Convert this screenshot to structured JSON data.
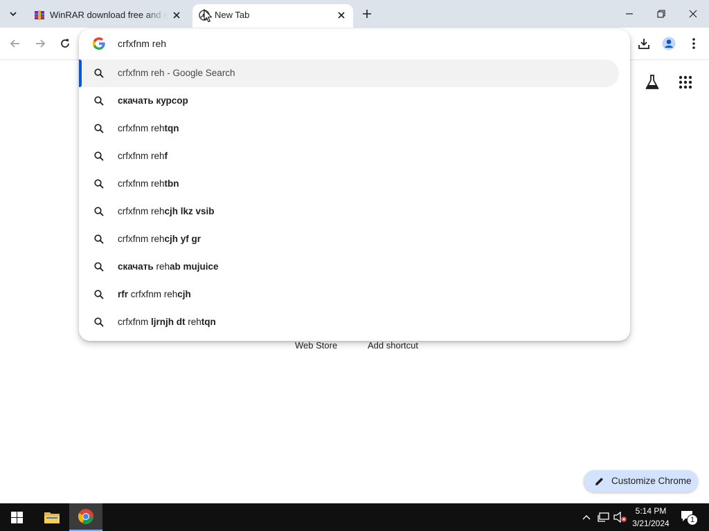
{
  "browser": {
    "tabs": [
      {
        "title": "WinRAR download free and support: WinRAR",
        "favicon": "winrar-icon",
        "active": false
      },
      {
        "title": "New Tab",
        "favicon": "chrome-newtab-icon",
        "active": true
      }
    ],
    "new_tab_label": "+",
    "toolbar_icons": [
      "back-icon",
      "forward-icon",
      "reload-icon",
      "download-icon",
      "profile-icon",
      "menu-icon"
    ]
  },
  "omnibox": {
    "input_value": "crfxfnm reh",
    "search_engine_icon": "google-g-icon",
    "suggestions": [
      {
        "parts": [
          {
            "t": "crfxfnm reh - Google Search",
            "b": false,
            "m": false
          }
        ],
        "selected": true
      },
      {
        "parts": [
          {
            "t": "скачать курсор",
            "b": true
          }
        ]
      },
      {
        "parts": [
          {
            "t": "crfxfnm reh",
            "b": false
          },
          {
            "t": "tqn",
            "b": true
          }
        ]
      },
      {
        "parts": [
          {
            "t": "crfxfnm reh",
            "b": false
          },
          {
            "t": "f",
            "b": true
          }
        ]
      },
      {
        "parts": [
          {
            "t": "crfxfnm reh",
            "b": false
          },
          {
            "t": "tbn",
            "b": true
          }
        ]
      },
      {
        "parts": [
          {
            "t": "crfxfnm reh",
            "b": false
          },
          {
            "t": "cjh lkz vsib",
            "b": true
          }
        ]
      },
      {
        "parts": [
          {
            "t": "crfxfnm reh",
            "b": false
          },
          {
            "t": "cjh yf gr",
            "b": true
          }
        ]
      },
      {
        "parts": [
          {
            "t": "скачать ",
            "b": true
          },
          {
            "t": "reh",
            "b": false
          },
          {
            "t": "ab mujuice",
            "b": true
          }
        ]
      },
      {
        "parts": [
          {
            "t": "rfr ",
            "b": true
          },
          {
            "t": "crfxfnm reh",
            "b": false
          },
          {
            "t": "cjh",
            "b": true
          }
        ]
      },
      {
        "parts": [
          {
            "t": "crfxfnm ",
            "b": false
          },
          {
            "t": "ljrnjh dt ",
            "b": true
          },
          {
            "t": "reh",
            "b": false
          },
          {
            "t": "tqn",
            "b": true
          }
        ]
      }
    ]
  },
  "ntp": {
    "shortcuts": [
      "Web Store",
      "Add shortcut"
    ],
    "customize_label": "Customize Chrome",
    "labs_icon": "labs-flask-icon",
    "apps_icon": "google-apps-icon"
  },
  "taskbar": {
    "time": "5:14 PM",
    "date": "3/21/2024",
    "notification_count": "1"
  },
  "colors": {
    "tabstrip_bg": "#dde3ea",
    "selected_accent": "#0b57d0",
    "customize_bg": "#d3e3fd",
    "taskbar_bg": "#101010"
  }
}
